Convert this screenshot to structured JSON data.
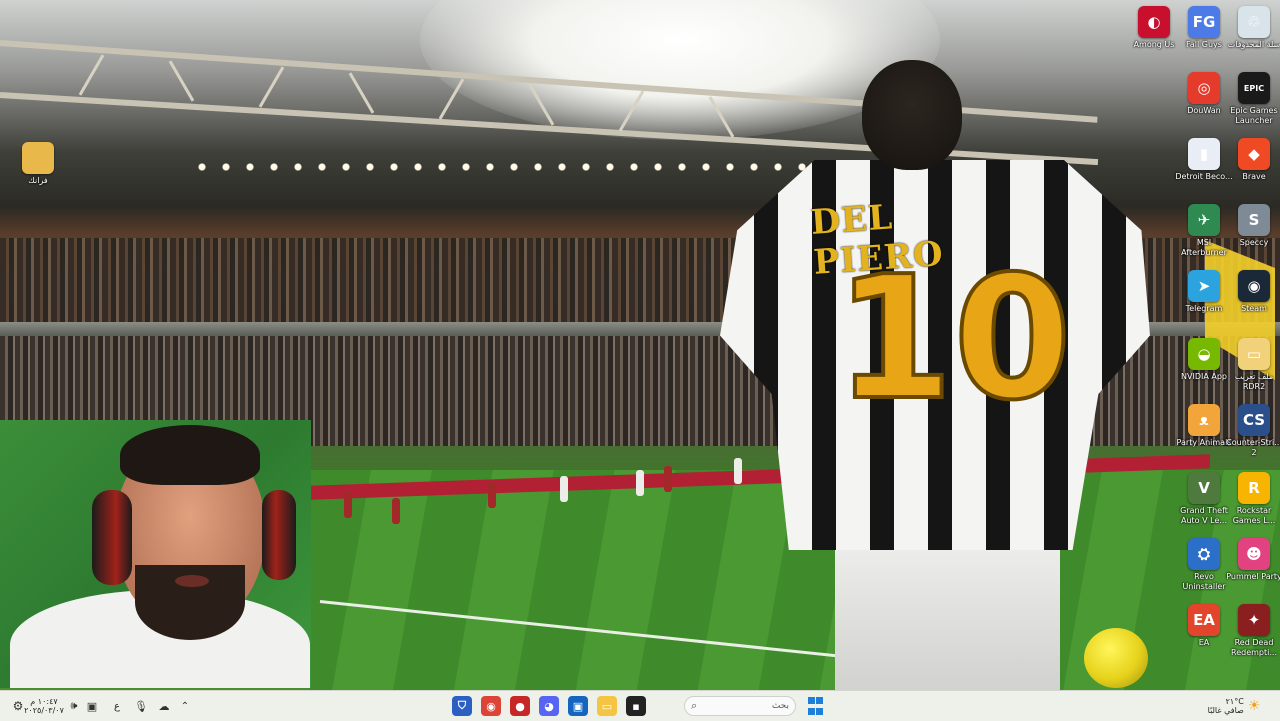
{
  "desktop": {
    "left_icons": [
      {
        "label": "فرانك",
        "icon": "folder-icon",
        "color": "#e8b84a"
      }
    ],
    "right_icons": [
      {
        "label": "Among Us",
        "icon": "among-us-icon",
        "color": "#c8102e",
        "glyph": "◐"
      },
      {
        "label": "Fall Guys",
        "icon": "fall-guys-icon",
        "color": "#4c7be8",
        "glyph": "FG"
      },
      {
        "label": "سلة المحذوفات",
        "icon": "recycle-bin-icon",
        "color": "#d9e3ea",
        "glyph": "♲"
      },
      {
        "label": "DouWan",
        "icon": "douwan-icon",
        "color": "#e43b2c",
        "glyph": "◎"
      },
      {
        "label": "Epic Games Launcher",
        "icon": "epic-games-icon",
        "color": "#1a1a1a",
        "glyph": "EPIC"
      },
      {
        "label": "Detroit Beco...",
        "icon": "detroit-icon",
        "color": "#e9eef6",
        "glyph": "▮"
      },
      {
        "label": "Brave",
        "icon": "brave-icon",
        "color": "#f04a25",
        "glyph": "◆"
      },
      {
        "label": "MSI Afterburner",
        "icon": "msi-afterburner-icon",
        "color": "#2f8a52",
        "glyph": "✈"
      },
      {
        "label": "Speccy",
        "icon": "speccy-icon",
        "color": "#7e8a96",
        "glyph": "S"
      },
      {
        "label": "Telegram",
        "icon": "telegram-icon",
        "color": "#2aa3df",
        "glyph": "➤"
      },
      {
        "label": "Steam",
        "icon": "steam-icon",
        "color": "#1b2838",
        "glyph": "◉"
      },
      {
        "label": "NVIDIA App",
        "icon": "nvidia-icon",
        "color": "#76b900",
        "glyph": "◒"
      },
      {
        "label": "ملف تعريب RDR2",
        "icon": "folder-icon",
        "color": "#f1d27a",
        "glyph": "▭"
      },
      {
        "label": "Party Animals",
        "icon": "party-animals-icon",
        "color": "#f2a53b",
        "glyph": "ᴥ"
      },
      {
        "label": "Counter-Stri... 2",
        "icon": "counter-strike-icon",
        "color": "#2b4f8a",
        "glyph": "CS"
      },
      {
        "label": "Grand Theft Auto V Le...",
        "icon": "gta-v-icon",
        "color": "#4f7a3e",
        "glyph": "V"
      },
      {
        "label": "Rockstar Games L...",
        "icon": "rockstar-icon",
        "color": "#f7b400",
        "glyph": "R"
      },
      {
        "label": "Revo Uninstaller",
        "icon": "revo-uninstaller-icon",
        "color": "#2c6fc9",
        "glyph": "⛭"
      },
      {
        "label": "Pummel Party",
        "icon": "pummel-party-icon",
        "color": "#e2427f",
        "glyph": "☻"
      },
      {
        "label": "EA",
        "icon": "ea-icon",
        "color": "#e2452b",
        "glyph": "EA"
      },
      {
        "label": "Red Dead Redempti...",
        "icon": "red-dead-icon",
        "color": "#8b1e1e",
        "glyph": "✦"
      }
    ]
  },
  "wallpaper": {
    "name_text": "DEL PIERO",
    "number_text": "10"
  },
  "taskbar": {
    "search_placeholder": "بحث",
    "weather_temp": "٢١°C",
    "weather_desc": "صافي غالبًا",
    "clock_time": "١٠:٤٧ م",
    "clock_date": "٢٠٢٥/٠٣/٠٧",
    "language": "ع",
    "apps": [
      {
        "name": "security-app-icon",
        "color": "#2b5fc4",
        "glyph": "⛉"
      },
      {
        "name": "chrome-icon",
        "color": "#db4437",
        "glyph": "◉"
      },
      {
        "name": "red-app-icon",
        "color": "#c62828",
        "glyph": "●"
      },
      {
        "name": "discord-icon",
        "color": "#5865f2",
        "glyph": "◕"
      },
      {
        "name": "store-icon",
        "color": "#1565c0",
        "glyph": "▣"
      },
      {
        "name": "file-explorer-icon",
        "color": "#f4c542",
        "glyph": "▭"
      },
      {
        "name": "terminal-icon",
        "color": "#222222",
        "glyph": "▪"
      }
    ]
  }
}
